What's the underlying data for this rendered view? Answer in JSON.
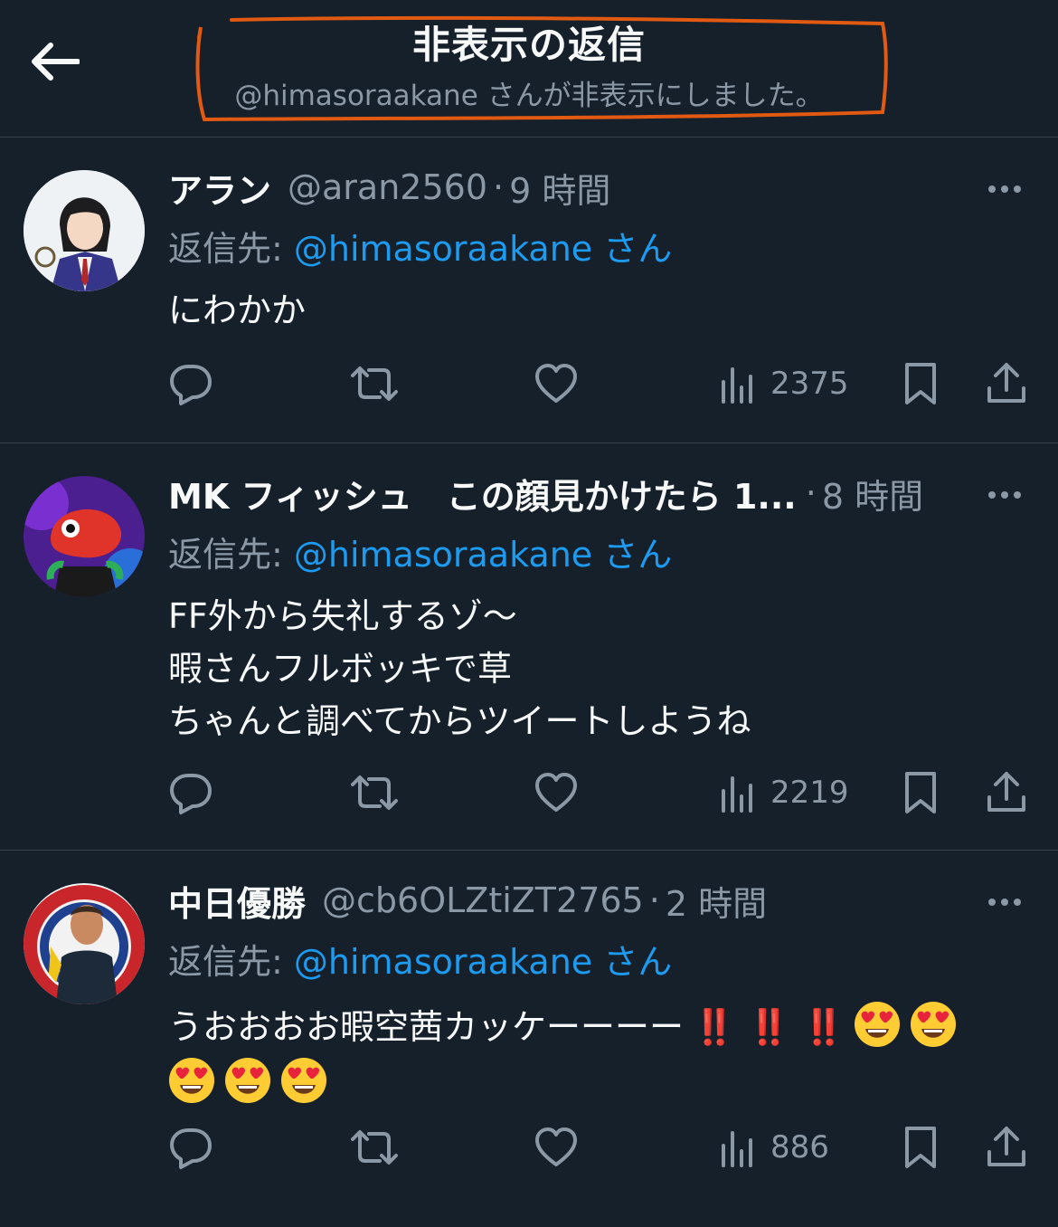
{
  "header": {
    "title": "非表示の返信",
    "subtitle": "@himasoraakane さんが非表示にしました。",
    "highlight_color": "#e25a12"
  },
  "colors": {
    "background": "#15202b",
    "text": "#f7f9f9",
    "muted": "#8b98a5",
    "link": "#1d9bf0",
    "divider": "#38444d",
    "exclaim": "#e0245e"
  },
  "tweets": [
    {
      "display_name": "アラン",
      "handle": "@aran2560",
      "separator": "·",
      "time": "9 時間",
      "reply_prefix": "返信先: ",
      "reply_mention": "@himasoraakane さん",
      "body_lines": [
        "にわかか"
      ],
      "views": "2375"
    },
    {
      "display_name": "MK フィッシュ　この顔見かけたら 1...",
      "handle": "",
      "separator": "·",
      "time": "8 時間",
      "reply_prefix": "返信先: ",
      "reply_mention": "@himasoraakane さん",
      "body_lines": [
        "FF外から失礼するゾ〜",
        "暇さんフルボッキで草",
        "ちゃんと調べてからツイートしようね"
      ],
      "views": "2219"
    },
    {
      "display_name": "中日優勝",
      "handle": "@cb6OLZtiZT2765",
      "separator": "·",
      "time": "2 時間",
      "reply_prefix": "返信先: ",
      "reply_mention": "@himasoraakane さん",
      "body_text": "うおおおお暇空茜カッケーーーー",
      "body_marks": "‼️ ‼️ ‼️",
      "emoji_name": "heart-eyes-emoji",
      "emoji_count_line1": 2,
      "emoji_count_line2": 3,
      "views": "886"
    }
  ],
  "icons": [
    "back-arrow-icon",
    "more-icon",
    "reply-icon",
    "retweet-icon",
    "like-icon",
    "views-icon",
    "bookmark-icon",
    "share-icon"
  ]
}
